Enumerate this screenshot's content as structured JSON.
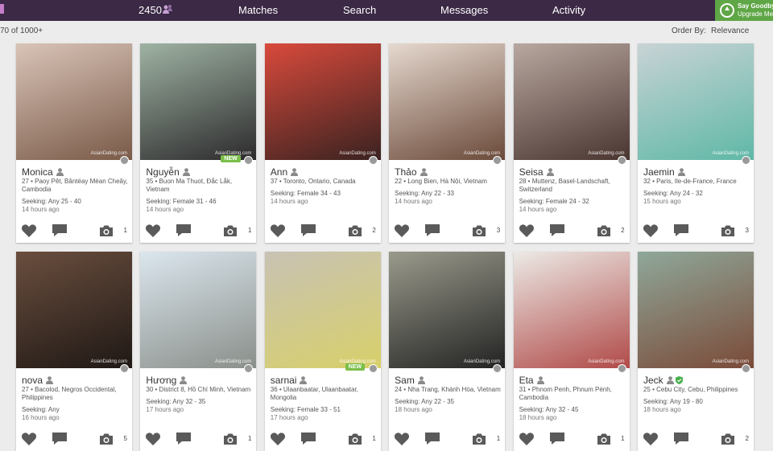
{
  "header": {
    "count": "2450",
    "nav": [
      "Matches",
      "Search",
      "Messages",
      "Activity"
    ],
    "promo_line1": "Say Goodbye",
    "promo_line2": "Upgrade Me"
  },
  "toolbar": {
    "results": "70 of 1000+",
    "order_label": "Order By:",
    "order_value": "Relevance"
  },
  "watermark": "AsianDating.com",
  "new_badge": "NEW",
  "profiles": [
    {
      "name": "Monica",
      "location": "27 • Paoy Pêt, Bântéay Méan Cheăy, Cambodia",
      "seeking": "Seeking: Any 25 - 40",
      "ago": "14 hours ago",
      "photos": "1",
      "new": false,
      "verified": false,
      "colors": [
        "#d9c4b8",
        "#7a5a48"
      ]
    },
    {
      "name": "Nguyễn",
      "location": "35 • Buon Ma Thuot, Đắc Lắk, Vietnam",
      "seeking": "Seeking: Female 31 - 46",
      "ago": "14 hours ago",
      "photos": "1",
      "new": true,
      "verified": false,
      "colors": [
        "#9fb3a3",
        "#2c2a2c"
      ]
    },
    {
      "name": "Ann",
      "location": "37 • Toronto, Ontario, Canada",
      "seeking": "Seeking: Female 34 - 43",
      "ago": "14 hours ago",
      "photos": "2",
      "new": false,
      "verified": false,
      "colors": [
        "#d94a3c",
        "#3a2220"
      ]
    },
    {
      "name": "Thảo",
      "location": "22 • Long Bien, Hà Nội, Vietnam",
      "seeking": "Seeking: Any 22 - 33",
      "ago": "14 hours ago",
      "photos": "3",
      "new": false,
      "verified": false,
      "colors": [
        "#e6d9cf",
        "#6b4a3a"
      ]
    },
    {
      "name": "Seisa",
      "location": "28 • Muttenz, Basel-Landschaft, Switzerland",
      "seeking": "Seeking: Female 24 - 32",
      "ago": "14 hours ago",
      "photos": "2",
      "new": false,
      "verified": false,
      "colors": [
        "#b8a8a0",
        "#4a3530"
      ]
    },
    {
      "name": "Jaemin",
      "location": "32 • Paris, Ile-de-France, France",
      "seeking": "Seeking: Any 24 - 32",
      "ago": "15 hours ago",
      "photos": "3",
      "new": false,
      "verified": false,
      "colors": [
        "#c9d3d6",
        "#5fb8a6"
      ]
    },
    {
      "name": "nova",
      "location": "27 • Bacolod, Negros Occidental, Philippines",
      "seeking": "Seeking: Any",
      "ago": "16 hours ago",
      "photos": "5",
      "new": false,
      "verified": false,
      "colors": [
        "#6a4e3e",
        "#1f1815"
      ]
    },
    {
      "name": "Hương",
      "location": "30 • District 8, Hồ Chí Minh, Vietnam",
      "seeking": "Seeking: Any 32 - 35",
      "ago": "17 hours ago",
      "photos": "1",
      "new": false,
      "verified": false,
      "colors": [
        "#dbe6ee",
        "#8a8f8a"
      ]
    },
    {
      "name": "sarnai",
      "location": "36 • Ulaanbaatar, Ulaanbaatar, Mongolia",
      "seeking": "Seeking: Female 33 - 51",
      "ago": "17 hours ago",
      "photos": "1",
      "new": true,
      "verified": false,
      "colors": [
        "#c8c2b4",
        "#d8d06a"
      ]
    },
    {
      "name": "Sam",
      "location": "24 • Nha Trang, Khánh Hòa, Vietnam",
      "seeking": "Seeking: Any 22 - 35",
      "ago": "18 hours ago",
      "photos": "1",
      "new": false,
      "verified": false,
      "colors": [
        "#9a9a8c",
        "#232323"
      ]
    },
    {
      "name": "Eta",
      "location": "31 • Phnom Penh, Phnum Pénh, Cambodia",
      "seeking": "Seeking: Any 32 - 45",
      "ago": "18 hours ago",
      "photos": "1",
      "new": false,
      "verified": false,
      "colors": [
        "#eceae6",
        "#b04a48"
      ]
    },
    {
      "name": "Jeck",
      "location": "25 • Cebu City, Cebu, Philippines",
      "seeking": "Seeking: Any 19 - 80",
      "ago": "18 hours ago",
      "photos": "2",
      "new": false,
      "verified": true,
      "colors": [
        "#8fa89a",
        "#7a4a38"
      ]
    }
  ]
}
